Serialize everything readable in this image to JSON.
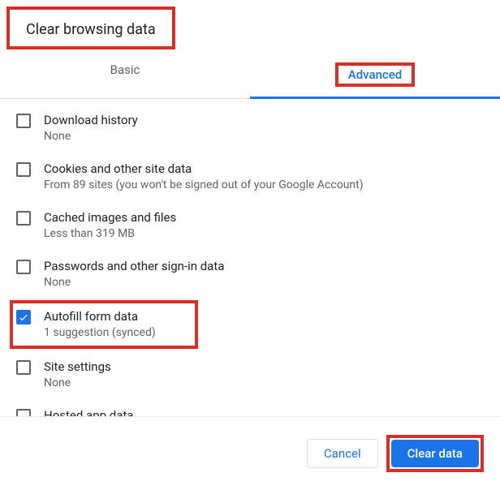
{
  "dialog": {
    "title": "Clear browsing data"
  },
  "tabs": {
    "basic": "Basic",
    "advanced": "Advanced"
  },
  "items": [
    {
      "title": "Download history",
      "sub": "None",
      "checked": false,
      "highlight": false
    },
    {
      "title": "Cookies and other site data",
      "sub": "From 89 sites (you won't be signed out of your Google Account)",
      "checked": false,
      "highlight": false
    },
    {
      "title": "Cached images and files",
      "sub": "Less than 319 MB",
      "checked": false,
      "highlight": false
    },
    {
      "title": "Passwords and other sign-in data",
      "sub": "None",
      "checked": false,
      "highlight": false
    },
    {
      "title": "Autofill form data",
      "sub": "1 suggestion (synced)",
      "checked": true,
      "highlight": true
    },
    {
      "title": "Site settings",
      "sub": "None",
      "checked": false,
      "highlight": false
    },
    {
      "title": "Hosted app data",
      "sub": "",
      "checked": false,
      "highlight": false
    }
  ],
  "footer": {
    "cancel": "Cancel",
    "clear": "Clear data"
  }
}
